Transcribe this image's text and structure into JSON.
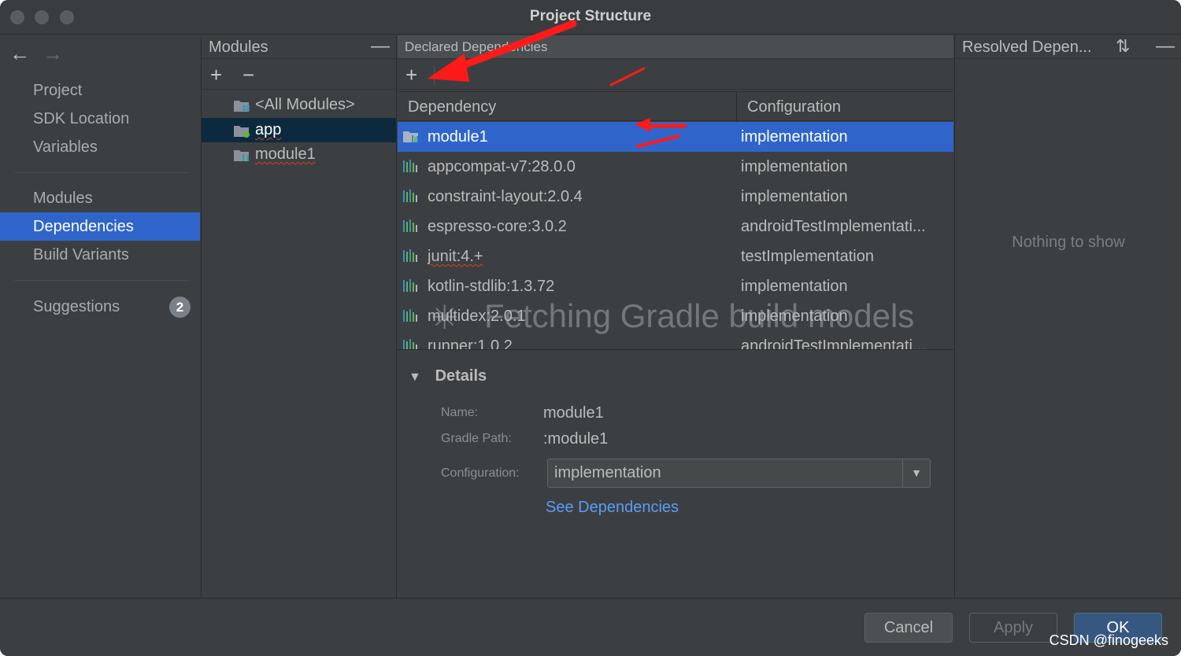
{
  "window": {
    "title": "Project Structure"
  },
  "left_nav": {
    "back_icon": "arrow-left-icon",
    "forward_icon": "arrow-right-icon",
    "items": [
      {
        "label": "Project"
      },
      {
        "label": "SDK Location"
      },
      {
        "label": "Variables"
      },
      {
        "label": "Modules"
      },
      {
        "label": "Dependencies",
        "selected": true
      },
      {
        "label": "Build Variants"
      },
      {
        "label": "Suggestions",
        "badge": "2"
      }
    ]
  },
  "modules_panel": {
    "title": "Modules",
    "items": [
      {
        "label": "<All Modules>",
        "icon": "all-modules-icon"
      },
      {
        "label": "app",
        "icon": "app-module-icon",
        "selected": true
      },
      {
        "label": "module1",
        "icon": "library-module-icon"
      }
    ]
  },
  "declared_panel": {
    "title": "Declared Dependencies",
    "columns": [
      "Dependency",
      "Configuration"
    ],
    "rows": [
      {
        "dependency": "module1",
        "configuration": "implementation",
        "icon": "module-dependency-icon",
        "selected": true
      },
      {
        "dependency": "appcompat-v7:28.0.0",
        "configuration": "implementation",
        "icon": "library-icon"
      },
      {
        "dependency": "constraint-layout:2.0.4",
        "configuration": "implementation",
        "icon": "library-icon"
      },
      {
        "dependency": "espresso-core:3.0.2",
        "configuration": "androidTestImplementati...",
        "icon": "library-icon"
      },
      {
        "dependency": "junit:4.+",
        "configuration": "testImplementation",
        "icon": "library-icon"
      },
      {
        "dependency": "kotlin-stdlib:1.3.72",
        "configuration": "implementation",
        "icon": "library-icon"
      },
      {
        "dependency": "multidex:2.0.1",
        "configuration": "implementation",
        "icon": "library-icon"
      },
      {
        "dependency": "runner:1.0.2",
        "configuration": "androidTestImplementati...",
        "icon": "library-icon"
      }
    ],
    "loading_text": "Fetching Gradle build models",
    "details": {
      "title": "Details",
      "name_label": "Name:",
      "name_value": "module1",
      "gradle_path_label": "Gradle Path:",
      "gradle_path_value": ":module1",
      "configuration_label": "Configuration:",
      "configuration_value": "implementation",
      "link": "See Dependencies"
    }
  },
  "resolved_panel": {
    "title": "Resolved Depen...",
    "empty_text": "Nothing to show"
  },
  "footer": {
    "cancel": "Cancel",
    "apply": "Apply",
    "ok": "OK",
    "watermark": "CSDN @finogeeks"
  },
  "colors": {
    "selection": "#2f65ca",
    "annotation_arrow": "#ff1a1a",
    "link": "#589df6"
  }
}
